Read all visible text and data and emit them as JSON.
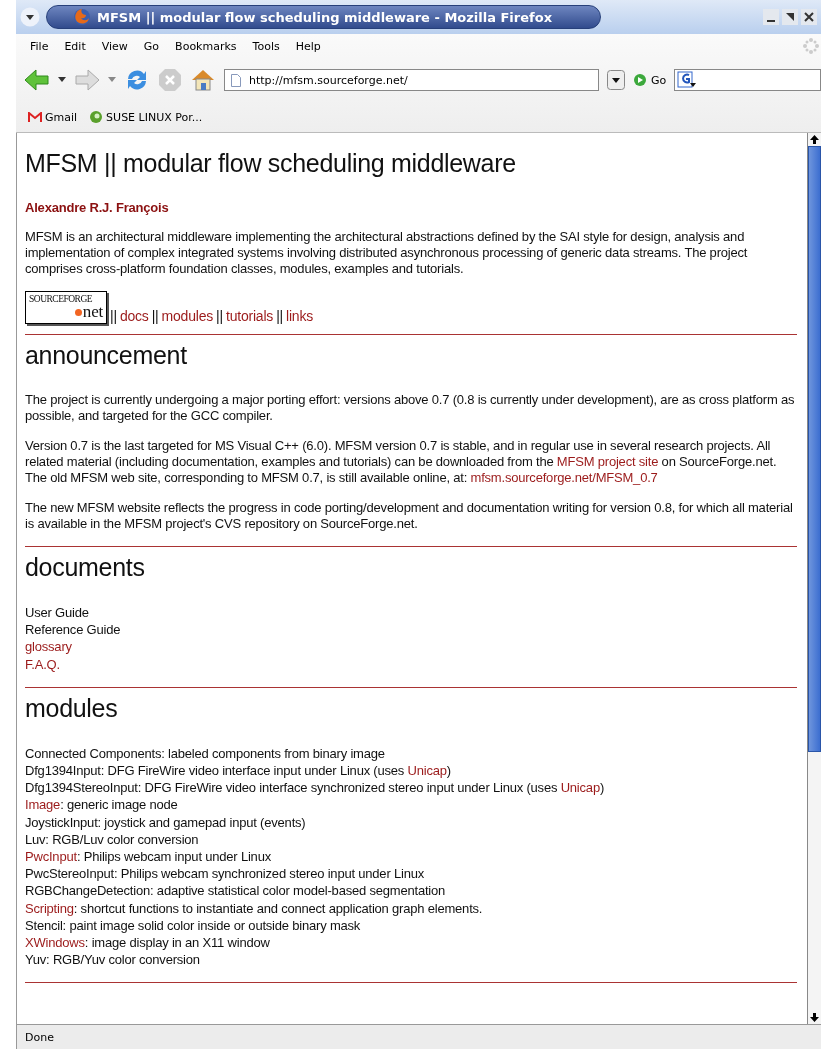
{
  "window": {
    "title": "MFSM || modular flow scheduling middleware - Mozilla Firefox"
  },
  "menu": [
    "File",
    "Edit",
    "View",
    "Go",
    "Bookmarks",
    "Tools",
    "Help"
  ],
  "address": {
    "value": "http://mfsm.sourceforge.net/"
  },
  "go_button": "Go",
  "bookmarks": [
    {
      "label": "Gmail",
      "kind": "gmail"
    },
    {
      "label": "SUSE LINUX Por...",
      "kind": "suse"
    }
  ],
  "page": {
    "title": "MFSM || modular flow scheduling middleware",
    "author": "Alexandre R.J. François",
    "intro": "MFSM is an architectural middleware implementing the architectural abstractions defined by the SAI style for design, analysis and implementation of complex integrated systems involving distributed asynchronous processing of generic data streams. The project comprises cross-platform foundation classes, modules, examples and tutorials.",
    "logo": {
      "top": "SOURCEFORGE",
      "bottom": "net"
    },
    "nav": [
      "docs",
      "modules",
      "tutorials",
      "links"
    ],
    "nav_separator": "||",
    "sections": [
      {
        "heading": "announcement",
        "kind": "paragraphs",
        "paragraphs": [
          [
            {
              "text": "The project is currently undergoing a major porting effort: versions above 0.7 (0.8 is currently under development), are as cross platform as possible, and targeted for the GCC compiler.",
              "kind": "text"
            }
          ],
          [
            {
              "text": "Version 0.7 is the last targeted for MS Visual C++ (6.0). MFSM version 0.7 is stable, and in regular use in several research projects. All related material (including documentation, examples and tutorials) can be downloaded from the ",
              "kind": "text"
            },
            {
              "text": "MFSM project site",
              "kind": "link"
            },
            {
              "text": " on SourceForge.net. The old MFSM web site, corresponding to MFSM 0.7, is still available online, at: ",
              "kind": "text"
            },
            {
              "text": "mfsm.sourceforge.net/MFSM_0.7",
              "kind": "link"
            }
          ],
          [
            {
              "text": "The new MFSM website reflects the progress in code porting/development and documentation writing for version 0.8, for which all material is available in the MFSM project's CVS repository on SourceForge.net.",
              "kind": "text"
            }
          ]
        ]
      },
      {
        "heading": "documents",
        "kind": "lines",
        "lines": [
          [
            {
              "text": "User Guide",
              "kind": "text"
            }
          ],
          [
            {
              "text": "Reference Guide",
              "kind": "text"
            }
          ],
          [
            {
              "text": "glossary",
              "kind": "link"
            }
          ],
          [
            {
              "text": "F.A.Q.",
              "kind": "link"
            }
          ]
        ]
      },
      {
        "heading": "modules",
        "kind": "lines",
        "lines": [
          [
            {
              "text": "Connected Components: labeled components from binary image",
              "kind": "text"
            }
          ],
          [
            {
              "text": "Dfg1394Input: DFG FireWire video interface input under Linux (uses ",
              "kind": "text"
            },
            {
              "text": "Unicap",
              "kind": "link"
            },
            {
              "text": ")",
              "kind": "text"
            }
          ],
          [
            {
              "text": "Dfg1394StereoInput: DFG FireWire video interface synchronized stereo input under Linux (uses ",
              "kind": "text"
            },
            {
              "text": "Unicap",
              "kind": "link"
            },
            {
              "text": ")",
              "kind": "text"
            }
          ],
          [
            {
              "text": "Image",
              "kind": "link"
            },
            {
              "text": ": generic image node",
              "kind": "text"
            }
          ],
          [
            {
              "text": "JoystickInput: joystick and gamepad input (events)",
              "kind": "text"
            }
          ],
          [
            {
              "text": "Luv: RGB/Luv color conversion",
              "kind": "text"
            }
          ],
          [
            {
              "text": "PwcInput",
              "kind": "link"
            },
            {
              "text": ": Philips webcam input under Linux",
              "kind": "text"
            }
          ],
          [
            {
              "text": "PwcStereoInput: Philips webcam synchronized stereo input under Linux",
              "kind": "text"
            }
          ],
          [
            {
              "text": "RGBChangeDetection: adaptive statistical color model-based segmentation",
              "kind": "text"
            }
          ],
          [
            {
              "text": "Scripting",
              "kind": "link"
            },
            {
              "text": ": shortcut functions to instantiate and connect application graph elements.",
              "kind": "text"
            }
          ],
          [
            {
              "text": "Stencil: paint image solid color inside or outside binary mask",
              "kind": "text"
            }
          ],
          [
            {
              "text": "XWindows",
              "kind": "link"
            },
            {
              "text": ": image display in an X11 window",
              "kind": "text"
            }
          ],
          [
            {
              "text": "Yuv: RGB/Yuv color conversion",
              "kind": "text"
            }
          ]
        ]
      }
    ]
  },
  "status_bar": "Done"
}
